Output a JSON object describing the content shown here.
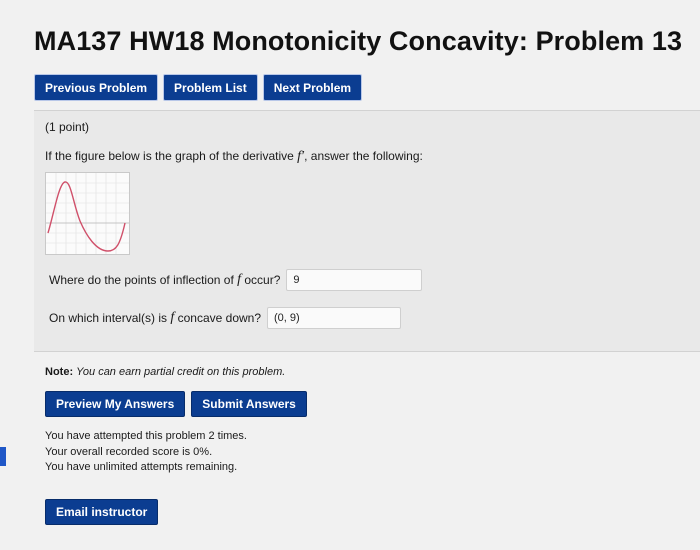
{
  "page": {
    "title": "MA137 HW18 Monotonicity Concavity: Problem 13"
  },
  "nav": {
    "previous_label": "Previous Problem",
    "list_label": "Problem List",
    "next_label": "Next Problem"
  },
  "problem": {
    "points": "(1 point)",
    "question_prefix": "If the figure below is the graph of the derivative",
    "derivative_symbol": "f′",
    "question_suffix": ", answer the following:",
    "q1_prefix": "Where do the points of inflection of",
    "q1_var": "f",
    "q1_suffix": "occur?",
    "q1_answer": "9",
    "q2_prefix": "On which interval(s) is",
    "q2_var": "f",
    "q2_suffix": "concave down?",
    "q2_answer": "(0, 9)"
  },
  "note": {
    "label": "Note:",
    "text": "You can earn partial credit on this problem."
  },
  "actions": {
    "preview_label": "Preview My Answers",
    "submit_label": "Submit Answers"
  },
  "status": {
    "attempts": "You have attempted this problem 2 times.",
    "score": "Your overall recorded score is 0%.",
    "remaining": "You have unlimited attempts remaining."
  },
  "email": {
    "label": "Email instructor"
  },
  "colors": {
    "button": "#0b3d91",
    "curve": "#d0506a",
    "panel": "#e9e9e9"
  }
}
